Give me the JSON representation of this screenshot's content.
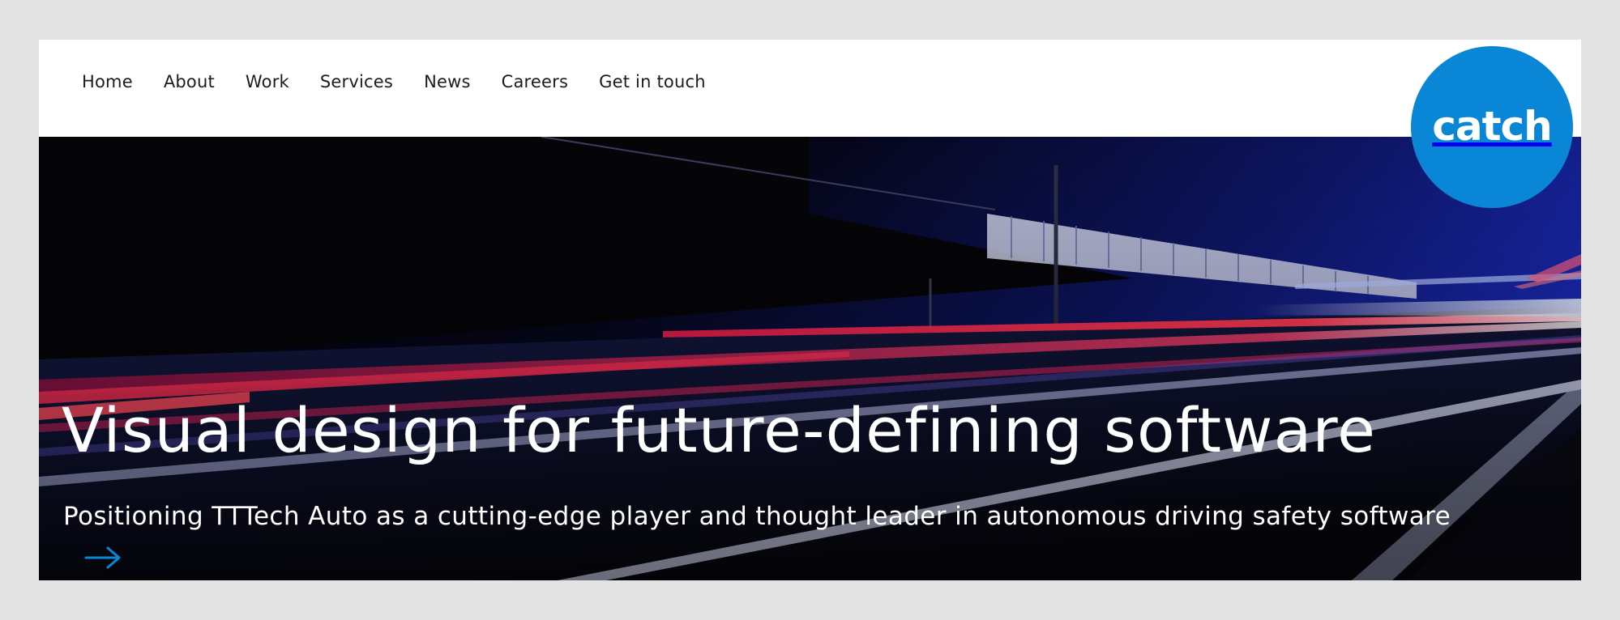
{
  "nav": {
    "items": [
      {
        "label": "Home"
      },
      {
        "label": "About"
      },
      {
        "label": "Work"
      },
      {
        "label": "Services"
      },
      {
        "label": "News"
      },
      {
        "label": "Careers"
      },
      {
        "label": "Get in touch"
      }
    ]
  },
  "logo": {
    "text": "catch",
    "color": "#0a86d6"
  },
  "hero": {
    "headline": "Visual design for future-defining software",
    "subline": "Positioning TTTech Auto as a cutting-edge player and thought leader in autonomous driving safety software",
    "link_icon": "arrow-right-icon",
    "accent_color": "#0a86d6"
  }
}
